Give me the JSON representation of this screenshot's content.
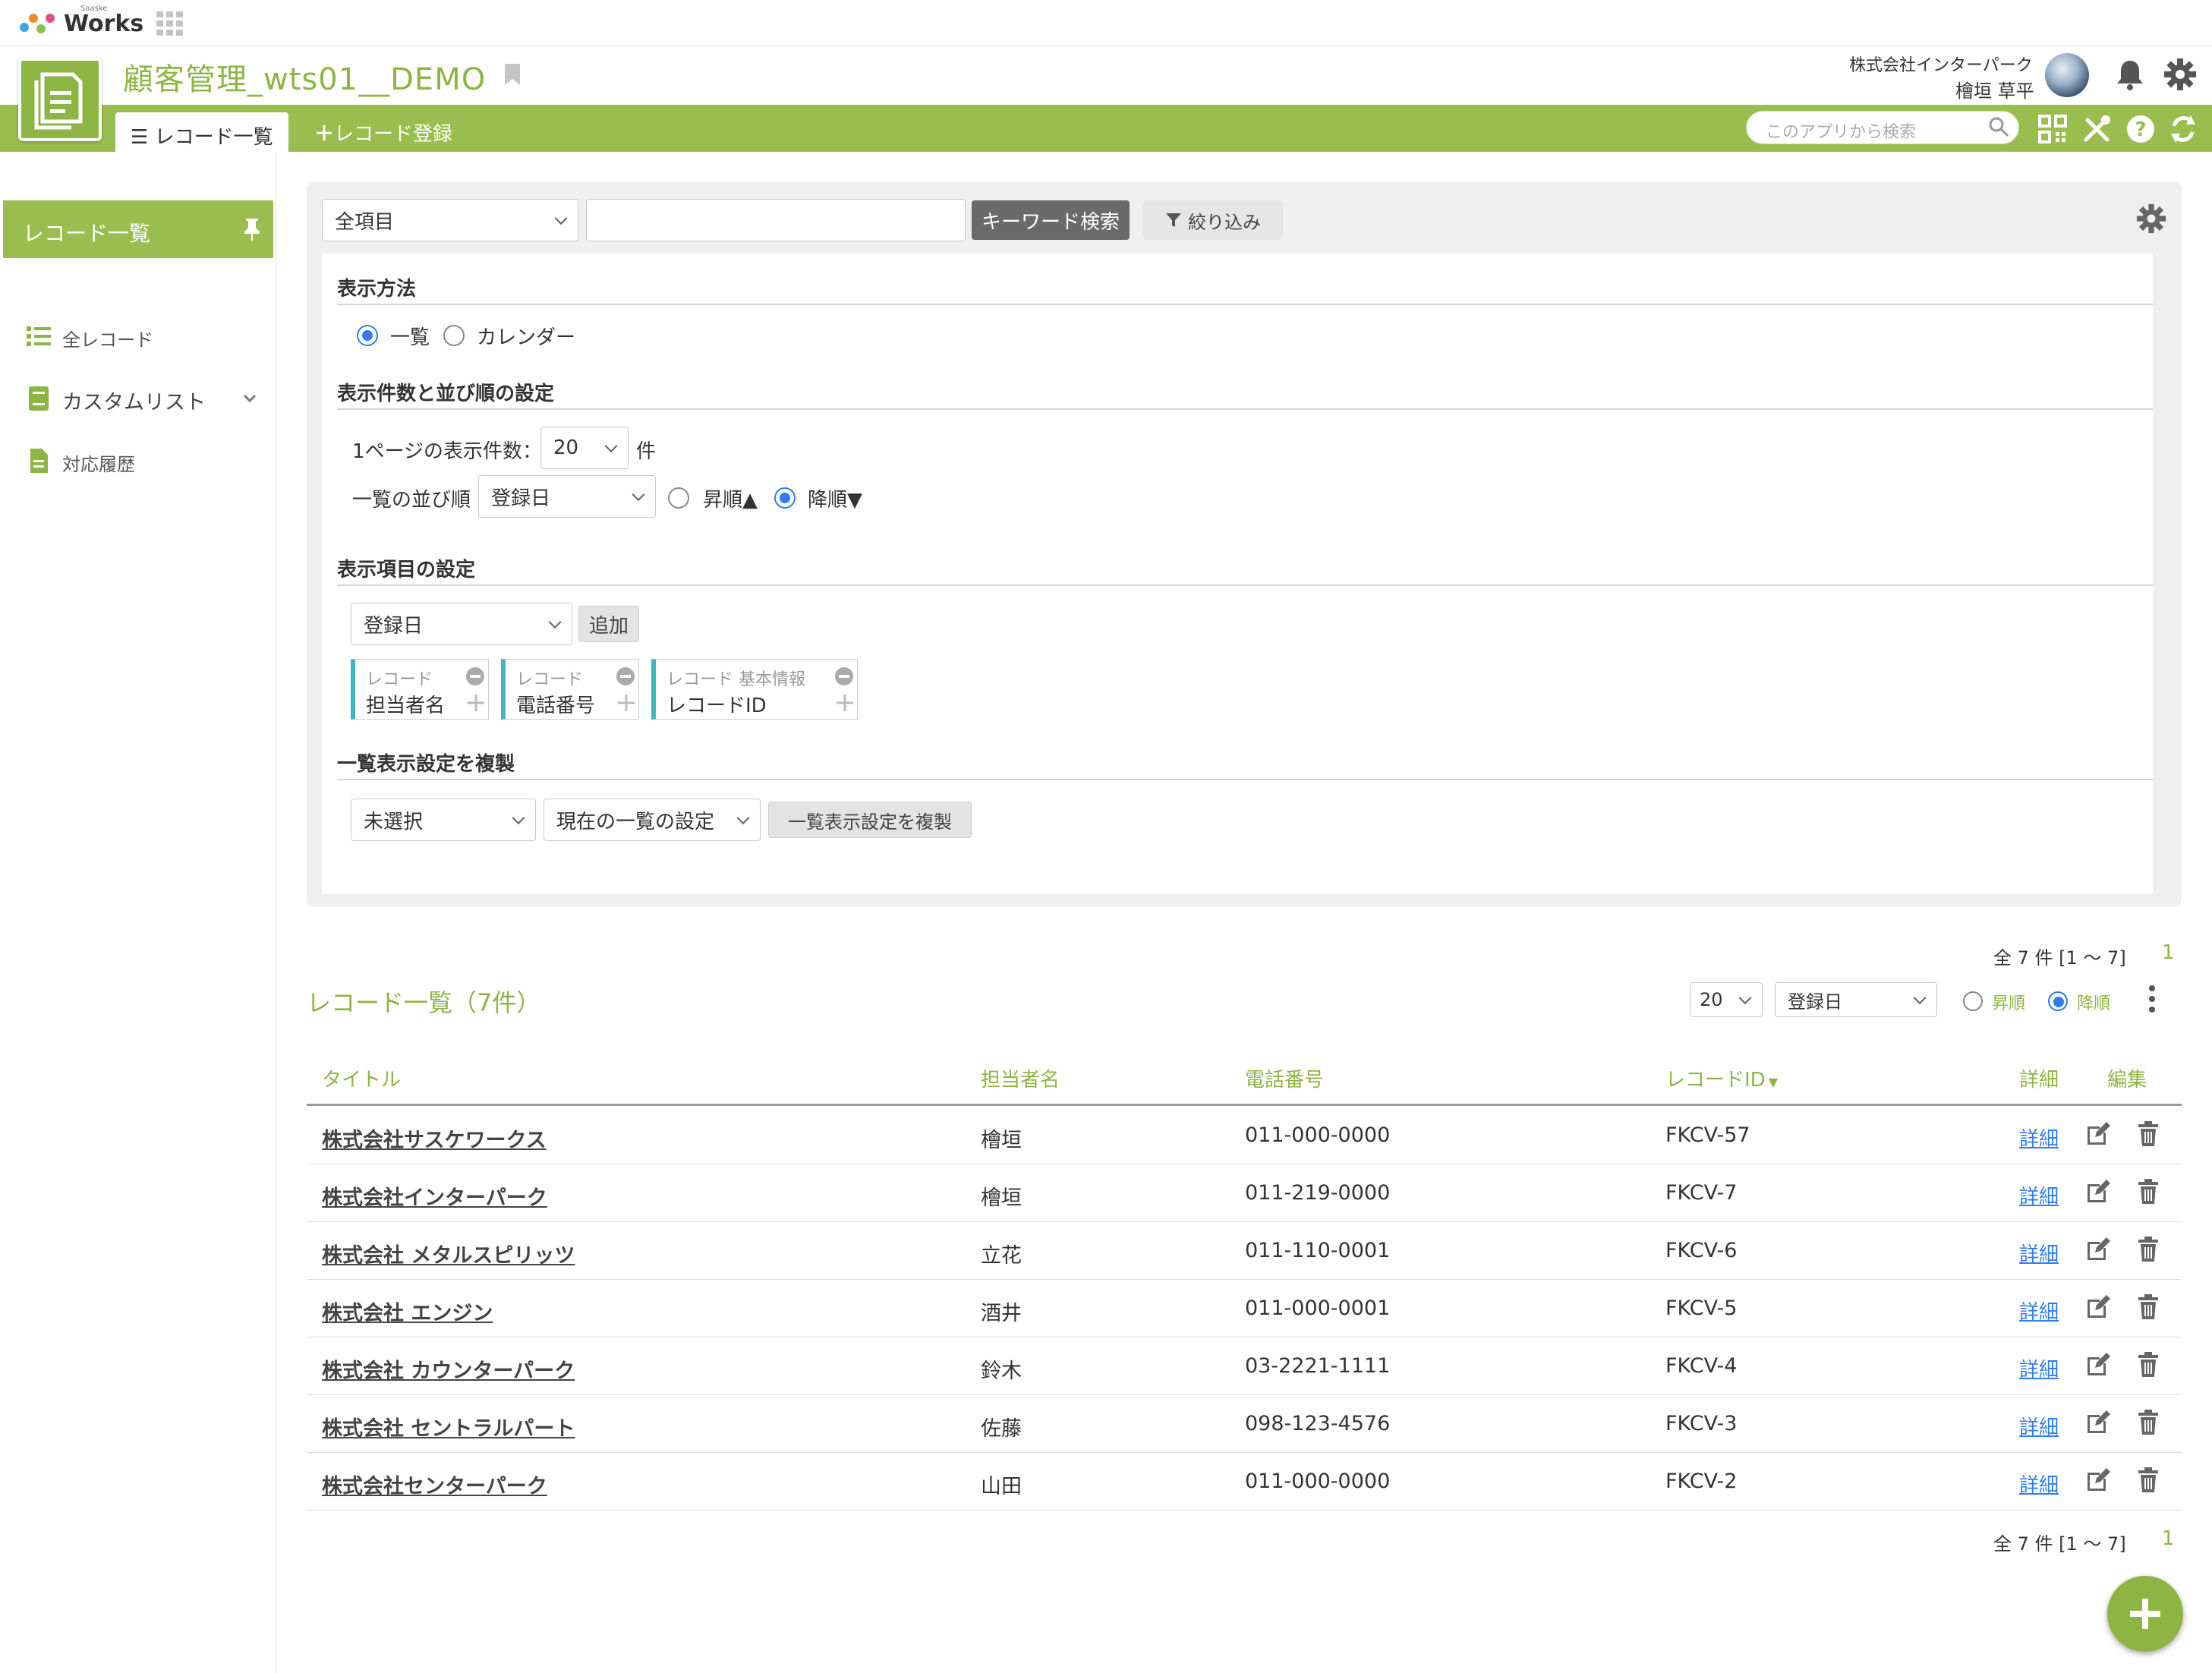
{
  "brand": {
    "name": "Works",
    "small": "Saaske"
  },
  "app": {
    "title": "顧客管理_wts01__DEMO"
  },
  "user": {
    "company": "株式会社インターパーク",
    "name": "檜垣 草平"
  },
  "tabs": {
    "list": "レコード一覧",
    "register": "レコード登録"
  },
  "search": {
    "placeholder": "このアプリから検索"
  },
  "sidebar": {
    "active": "レコード一覧",
    "items": [
      {
        "label": "全レコード"
      },
      {
        "label": "カスタムリスト"
      },
      {
        "label": "対応履歴"
      }
    ]
  },
  "filter": {
    "field_select": "全項目",
    "keyword_value": "",
    "keyword_button": "キーワード検索",
    "narrow_button": "絞り込み"
  },
  "display": {
    "heading": "表示方法",
    "options": [
      "一覧",
      "カレンダー"
    ],
    "selected": "一覧"
  },
  "count_sort": {
    "heading": "表示件数と並び順の設定",
    "per_page_label": "1ページの表示件数：",
    "per_page_value": "20",
    "per_page_unit": "件",
    "order_label": "一覧の並び順",
    "order_field": "登録日",
    "asc": "昇順▲",
    "desc": "降順▼",
    "selected": "降順"
  },
  "columns_setting": {
    "heading": "表示項目の設定",
    "field_select": "登録日",
    "add_button": "追加",
    "chips": [
      {
        "category": "レコード",
        "name": "担当者名"
      },
      {
        "category": "レコード",
        "name": "電話番号"
      },
      {
        "category": "レコード 基本情報",
        "name": "レコードID"
      }
    ]
  },
  "copy_setting": {
    "heading": "一覧表示設定を複製",
    "source_select": "未選択",
    "target_select": "現在の一覧の設定",
    "copy_button": "一覧表示設定を複製"
  },
  "list": {
    "count_text": "全 7 件 [1 〜 7]",
    "page": "1",
    "title": "レコード一覧（7件）",
    "per_page": "20",
    "sort_field": "登録日",
    "asc": "昇順",
    "desc": "降順",
    "selected": "降順",
    "headers": [
      "タイトル",
      "担当者名",
      "電話番号",
      "レコードID",
      "詳細",
      "編集"
    ],
    "detail_link": "詳細",
    "rows": [
      {
        "title": "株式会社サスケワークス",
        "person": "檜垣",
        "phone": "011-000-0000",
        "id": "FKCV-57"
      },
      {
        "title": "株式会社インターパーク",
        "person": "檜垣",
        "phone": "011-219-0000",
        "id": "FKCV-7"
      },
      {
        "title": "株式会社 メタルスピリッツ",
        "person": "立花",
        "phone": "011-110-0001",
        "id": "FKCV-6"
      },
      {
        "title": "株式会社 エンジン",
        "person": "酒井",
        "phone": "011-000-0001",
        "id": "FKCV-5"
      },
      {
        "title": "株式会社 カウンターパーク",
        "person": "鈴木",
        "phone": "03-2221-1111",
        "id": "FKCV-4"
      },
      {
        "title": "株式会社 セントラルパート",
        "person": "佐藤",
        "phone": "098-123-4576",
        "id": "FKCV-3"
      },
      {
        "title": "株式会社センターパーク",
        "person": "山田",
        "phone": "011-000-0000",
        "id": "FKCV-2"
      }
    ]
  },
  "colors": {
    "accent": "#8db543",
    "bar": "#9bbd50",
    "link": "#2f7cf6",
    "chip_border": "#3fb6c0"
  }
}
